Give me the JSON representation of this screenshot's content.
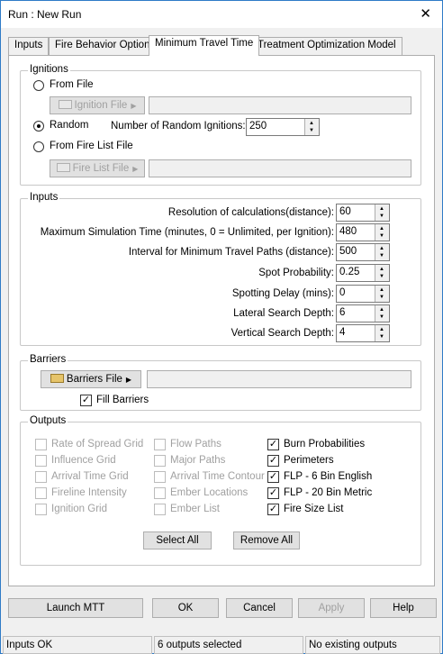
{
  "window": {
    "title": "Run : New Run",
    "close_glyph": "✕"
  },
  "tabs": [
    "Inputs",
    "Fire Behavior Options",
    "Minimum Travel Time",
    "Treatment Optimization Model"
  ],
  "ignitions": {
    "group_label": "Ignitions",
    "from_file": "From File",
    "ignition_file_btn": "Ignition File",
    "random": "Random",
    "num_random_label": "Number of Random Ignitions:",
    "num_random_value": "250",
    "from_fire_list": "From Fire List File",
    "fire_list_btn": "Fire List File",
    "selected": "random"
  },
  "inputs": {
    "group_label": "Inputs",
    "rows": [
      {
        "label": "Resolution of calculations(distance):",
        "value": "60"
      },
      {
        "label": "Maximum Simulation Time (minutes, 0 = Unlimited, per Ignition):",
        "value": "480"
      },
      {
        "label": "Interval for Minimum Travel Paths (distance):",
        "value": "500"
      },
      {
        "label": "Spot Probability:",
        "value": "0.25"
      },
      {
        "label": "Spotting Delay (mins):",
        "value": "0"
      },
      {
        "label": "Lateral Search Depth:",
        "value": "6"
      },
      {
        "label": "Vertical Search Depth:",
        "value": "4"
      }
    ]
  },
  "barriers": {
    "group_label": "Barriers",
    "btn": "Barriers File",
    "fill_label": "Fill Barriers",
    "fill_checked": true
  },
  "outputs": {
    "group_label": "Outputs",
    "col1": [
      {
        "label": "Rate of Spread Grid",
        "checked": false,
        "enabled": false
      },
      {
        "label": "Influence Grid",
        "checked": false,
        "enabled": false
      },
      {
        "label": "Arrival Time Grid",
        "checked": false,
        "enabled": false
      },
      {
        "label": "Fireline Intensity",
        "checked": false,
        "enabled": false
      },
      {
        "label": "Ignition Grid",
        "checked": false,
        "enabled": false
      }
    ],
    "col2": [
      {
        "label": "Flow Paths",
        "checked": false,
        "enabled": false
      },
      {
        "label": "Major Paths",
        "checked": false,
        "enabled": false
      },
      {
        "label": "Arrival Time Contour",
        "checked": false,
        "enabled": false
      },
      {
        "label": "Ember Locations",
        "checked": false,
        "enabled": false
      },
      {
        "label": "Ember List",
        "checked": false,
        "enabled": false
      }
    ],
    "col3": [
      {
        "label": "Burn Probabilities",
        "checked": true,
        "enabled": true
      },
      {
        "label": "Perimeters",
        "checked": true,
        "enabled": true
      },
      {
        "label": "FLP - 6 Bin English",
        "checked": true,
        "enabled": true
      },
      {
        "label": "FLP - 20 Bin Metric",
        "checked": true,
        "enabled": true
      },
      {
        "label": "Fire Size List",
        "checked": true,
        "enabled": true
      }
    ],
    "select_all": "Select All",
    "remove_all": "Remove All"
  },
  "footer": {
    "launch": "Launch MTT",
    "ok": "OK",
    "cancel": "Cancel",
    "apply": "Apply",
    "help": "Help"
  },
  "statusbar": [
    "Inputs OK",
    "6 outputs selected",
    "No existing outputs"
  ],
  "colors": {
    "titlebar_border": "#2f7bc7",
    "dialog_bg": "#f0f0f0",
    "disabled_text": "#a0a0a0",
    "folder": "#e6c46a"
  }
}
